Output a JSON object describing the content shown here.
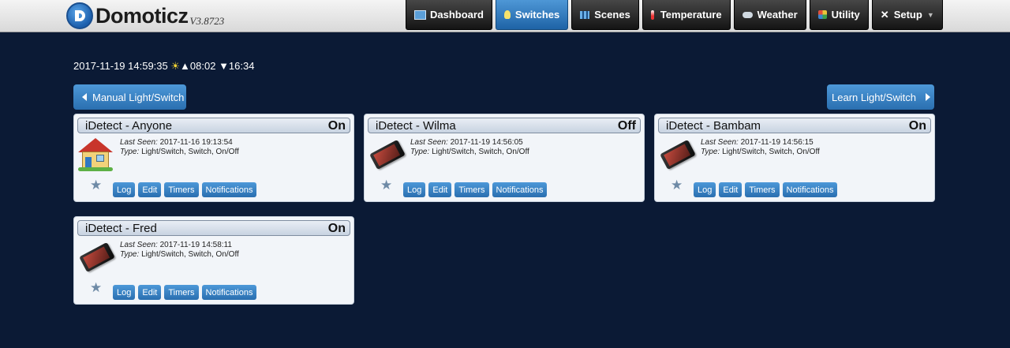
{
  "app": {
    "name": "Domoticz",
    "version": "V3.8723",
    "logo_icon": "domoticz-logo-icon"
  },
  "nav": [
    {
      "label": "Dashboard",
      "icon": "dashboard-icon",
      "active": false
    },
    {
      "label": "Switches",
      "icon": "lightbulb-icon",
      "active": true
    },
    {
      "label": "Scenes",
      "icon": "clapperboard-icon",
      "active": false
    },
    {
      "label": "Temperature",
      "icon": "thermometer-icon",
      "active": false
    },
    {
      "label": "Weather",
      "icon": "cloud-icon",
      "active": false
    },
    {
      "label": "Utility",
      "icon": "utility-icon",
      "active": false
    },
    {
      "label": "Setup",
      "icon": "tools-icon",
      "active": false,
      "dropdown": true
    }
  ],
  "status_bar": {
    "datetime": "2017-11-19 14:59:35",
    "sunrise": "▲08:02",
    "sunset": "▼16:34"
  },
  "buttons": {
    "manual": "Manual Light/Switch",
    "learn": "Learn Light/Switch"
  },
  "labels": {
    "last_seen": "Last Seen:",
    "type": "Type:"
  },
  "device_actions": [
    "Log",
    "Edit",
    "Timers",
    "Notifications"
  ],
  "devices": [
    {
      "name": "iDetect - Anyone",
      "status": "On",
      "last_seen": "2017-11-16 19:13:54",
      "type": "Light/Switch, Switch, On/Off",
      "icon": "house-icon"
    },
    {
      "name": "iDetect - Wilma",
      "status": "Off",
      "last_seen": "2017-11-19 14:56:05",
      "type": "Light/Switch, Switch, On/Off",
      "icon": "smartphone-icon"
    },
    {
      "name": "iDetect - Bambam",
      "status": "On",
      "last_seen": "2017-11-19 14:56:15",
      "type": "Light/Switch, Switch, On/Off",
      "icon": "smartphone-icon"
    },
    {
      "name": "iDetect - Fred",
      "status": "On",
      "last_seen": "2017-11-19 14:58:11",
      "type": "Light/Switch, Switch, On/Off",
      "icon": "smartphone-icon"
    }
  ],
  "colors": {
    "background": "#0b1a35",
    "accent": "#2a6fb0",
    "card": "#f2f5f9"
  }
}
